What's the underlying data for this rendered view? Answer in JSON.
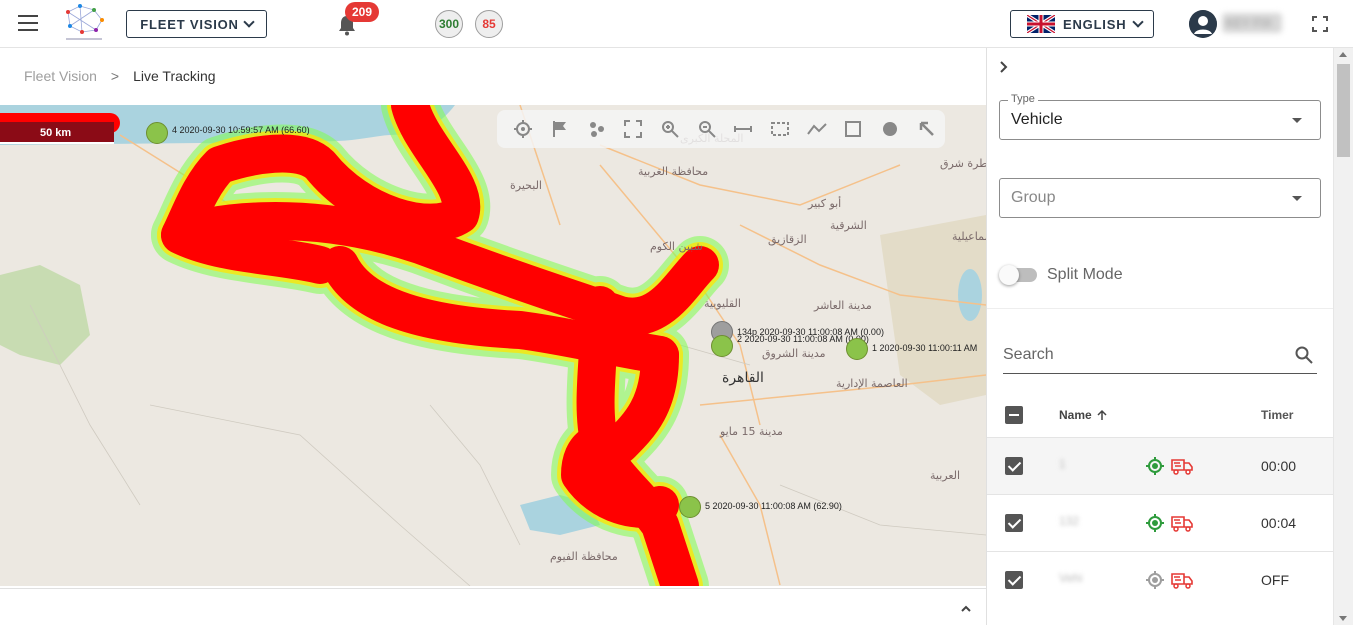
{
  "header": {
    "app_selector": "FLEET VISION",
    "notification_count": "209",
    "counter_online": "300",
    "counter_offline": "85",
    "language": "ENGLISH",
    "username": "KEY FIX",
    "colors": {
      "badge": "#e53935",
      "online": "#2e7d32",
      "offline": "#e53935",
      "dark": "#2b3a4a"
    }
  },
  "breadcrumb": {
    "root": "Fleet Vision",
    "separator": ">",
    "current": "Live Tracking"
  },
  "map": {
    "scale_label": "50 km",
    "toolbar_icons": [
      "locate-icon",
      "flag-icon",
      "cluster-icon",
      "fit-bounds-icon",
      "zoom-in-icon",
      "zoom-out-icon",
      "ruler-icon",
      "select-area-icon",
      "polyline-icon",
      "rectangle-icon",
      "circle-icon",
      "pointer-icon"
    ],
    "heatmap_color": "#ff0000",
    "vehicles": [
      {
        "label": "4 2020-09-30 10:59:57 AM (66.60)",
        "status": "moving"
      },
      {
        "label": "134p 2020-09-30 11:00:08 AM (0.00)",
        "status": "stopped"
      },
      {
        "label": "2 2020-09-30 11:00:08 AM (0.00)",
        "status": "moving"
      },
      {
        "label": "1 2020-09-30 11:00:11 AM",
        "status": "moving"
      },
      {
        "label": "5 2020-09-30 11:00:08 AM (62.90)",
        "status": "moving"
      }
    ],
    "place_labels": [
      "المحلة الكبرى",
      "محافظة الغربية",
      "البحيرة",
      "أبو كبير",
      "الزقازيق",
      "الشرقية",
      "شبين الكوم",
      "القليوبية",
      "مدينة العاشر من رمضان",
      "مدينة الشروق",
      "العاصمة الإدارية",
      "القاهرة",
      "مدينة 15 مايو",
      "محافظة الفيوم",
      "العربية",
      "الإسماعيلية",
      "قطرة شرق"
    ]
  },
  "right_panel": {
    "type_label": "Type",
    "type_value": "Vehicle",
    "group_placeholder": "Group",
    "split_mode_label": "Split Mode",
    "search_placeholder": "Search",
    "columns": {
      "name": "Name",
      "timer": "Timer"
    },
    "rows": [
      {
        "name": "1",
        "timer": "00:00",
        "tracking": "active",
        "truck_status": "red"
      },
      {
        "name": "132",
        "timer": "00:04",
        "tracking": "active",
        "truck_status": "red"
      },
      {
        "name": "Vehi",
        "timer": "OFF",
        "tracking": "inactive",
        "truck_status": "red"
      }
    ]
  }
}
